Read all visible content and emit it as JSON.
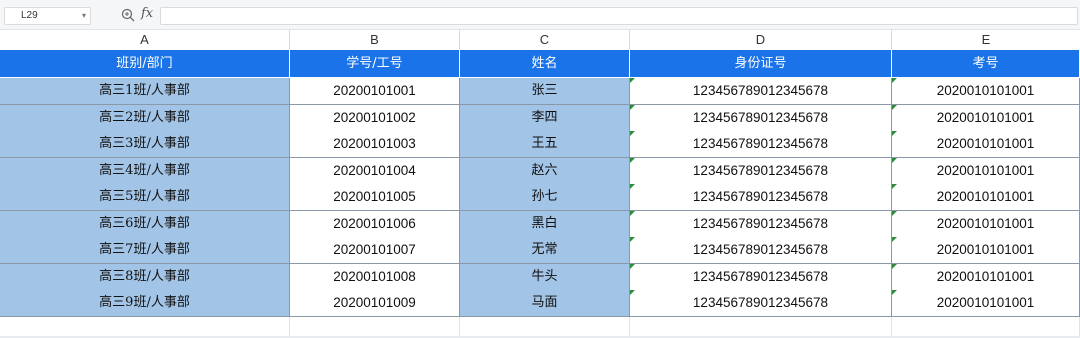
{
  "formula_bar": {
    "cell_ref": "L29",
    "fx_label": "fx",
    "formula": ""
  },
  "columns": [
    "A",
    "B",
    "C",
    "D",
    "E"
  ],
  "header": [
    "班别/部门",
    "学号/工号",
    "姓名",
    "身份证号",
    "考号"
  ],
  "rows": [
    [
      "高三1班/人事部",
      "20200101001",
      "张三",
      "123456789012345678",
      "2020010101001"
    ],
    [
      "高三2班/人事部",
      "20200101002",
      "李四",
      "123456789012345678",
      "2020010101001"
    ],
    [
      "高三3班/人事部",
      "20200101003",
      "王五",
      "123456789012345678",
      "2020010101001"
    ],
    [
      "高三4班/人事部",
      "20200101004",
      "赵六",
      "123456789012345678",
      "2020010101001"
    ],
    [
      "高三5班/人事部",
      "20200101005",
      "孙七",
      "123456789012345678",
      "2020010101001"
    ],
    [
      "高三6班/人事部",
      "20200101006",
      "黑白",
      "123456789012345678",
      "2020010101001"
    ],
    [
      "高三7班/人事部",
      "20200101007",
      "无常",
      "123456789012345678",
      "2020010101001"
    ],
    [
      "高三8班/人事部",
      "20200101008",
      "牛头",
      "123456789012345678",
      "2020010101001"
    ],
    [
      "高三9班/人事部",
      "20200101009",
      "马面",
      "123456789012345678",
      "2020010101001"
    ]
  ],
  "colors": {
    "header_fill": "#1a73e8",
    "highlight_fill": "#a2c4e6",
    "error_triangle": "#2e8b3e"
  }
}
